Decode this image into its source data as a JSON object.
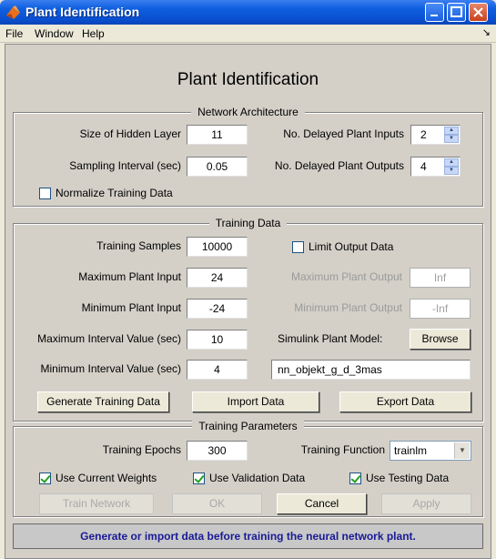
{
  "window": {
    "title": "Plant Identification"
  },
  "menu": {
    "items": [
      "File",
      "Window",
      "Help"
    ]
  },
  "heading": "Plant Identification",
  "network_architecture": {
    "title": "Network Architecture",
    "hidden_layer_label": "Size of Hidden Layer",
    "hidden_layer_value": "11",
    "sampling_label": "Sampling Interval (sec)",
    "sampling_value": "0.05",
    "delayed_inputs_label": "No. Delayed Plant Inputs",
    "delayed_inputs_value": "2",
    "delayed_outputs_label": "No. Delayed Plant Outputs",
    "delayed_outputs_value": "4",
    "normalize_label": "Normalize Training Data",
    "normalize_checked": false
  },
  "training_data": {
    "title": "Training Data",
    "samples_label": "Training Samples",
    "samples_value": "10000",
    "limit_output_label": "Limit Output Data",
    "max_input_label": "Maximum Plant Input",
    "max_input_value": "24",
    "min_input_label": "Minimum Plant Input",
    "min_input_value": "-24",
    "max_output_label": "Maximum Plant Output",
    "max_output_value": "Inf",
    "min_output_label": "Minimum Plant Output",
    "min_output_value": "-Inf",
    "max_interval_label": "Maximum Interval Value (sec)",
    "max_interval_value": "10",
    "min_interval_label": "Minimum Interval Value (sec)",
    "min_interval_value": "4",
    "simulink_label": "Simulink Plant Model:",
    "browse_label": "Browse",
    "model_name": "nn_objekt_g_d_3mas",
    "generate_label": "Generate Training Data",
    "import_label": "Import Data",
    "export_label": "Export Data"
  },
  "training_parameters": {
    "title": "Training Parameters",
    "epochs_label": "Training Epochs",
    "epochs_value": "300",
    "function_label": "Training Function",
    "function_value": "trainlm",
    "use_current_weights": "Use Current Weights",
    "use_validation": "Use Validation Data",
    "use_testing": "Use Testing Data",
    "train_label": "Train Network",
    "ok_label": "OK",
    "cancel_label": "Cancel",
    "apply_label": "Apply"
  },
  "status_message": "Generate or import data before training the neural network plant.",
  "colors": {
    "titlebar": "#0a4fcf",
    "status_text": "#1a1a96"
  }
}
